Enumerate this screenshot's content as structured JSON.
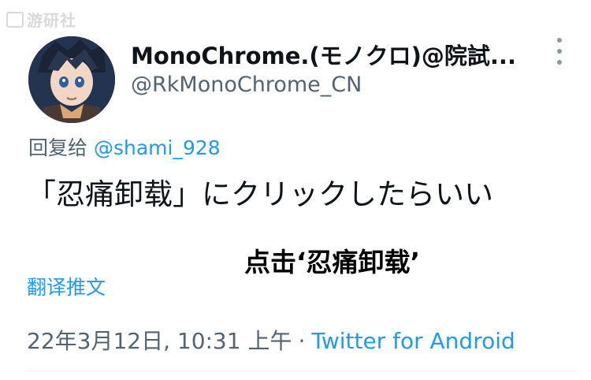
{
  "watermark": {
    "text": "游研社"
  },
  "tweet": {
    "display_name": "MonoChrome.(モノクロ)@院試...",
    "handle": "@RkMonoChrome_CN",
    "reply_prefix": "回复给 ",
    "reply_mention": "@shami_928",
    "text": "「忍痛卸载」にクリックしたらいい",
    "translate_label": "翻译推文",
    "timestamp": "22年3月12日, 10:31 上午",
    "separator": "·",
    "source": "Twitter for Android"
  },
  "overlay": {
    "caption": "点击‘忍痛卸载’"
  },
  "icons": {
    "more": "more-vertical-icon",
    "avatar": "anime-character-avatar"
  },
  "colors": {
    "link": "#1d9bf0",
    "secondary_text": "#536471",
    "primary_text": "#0f1419"
  }
}
